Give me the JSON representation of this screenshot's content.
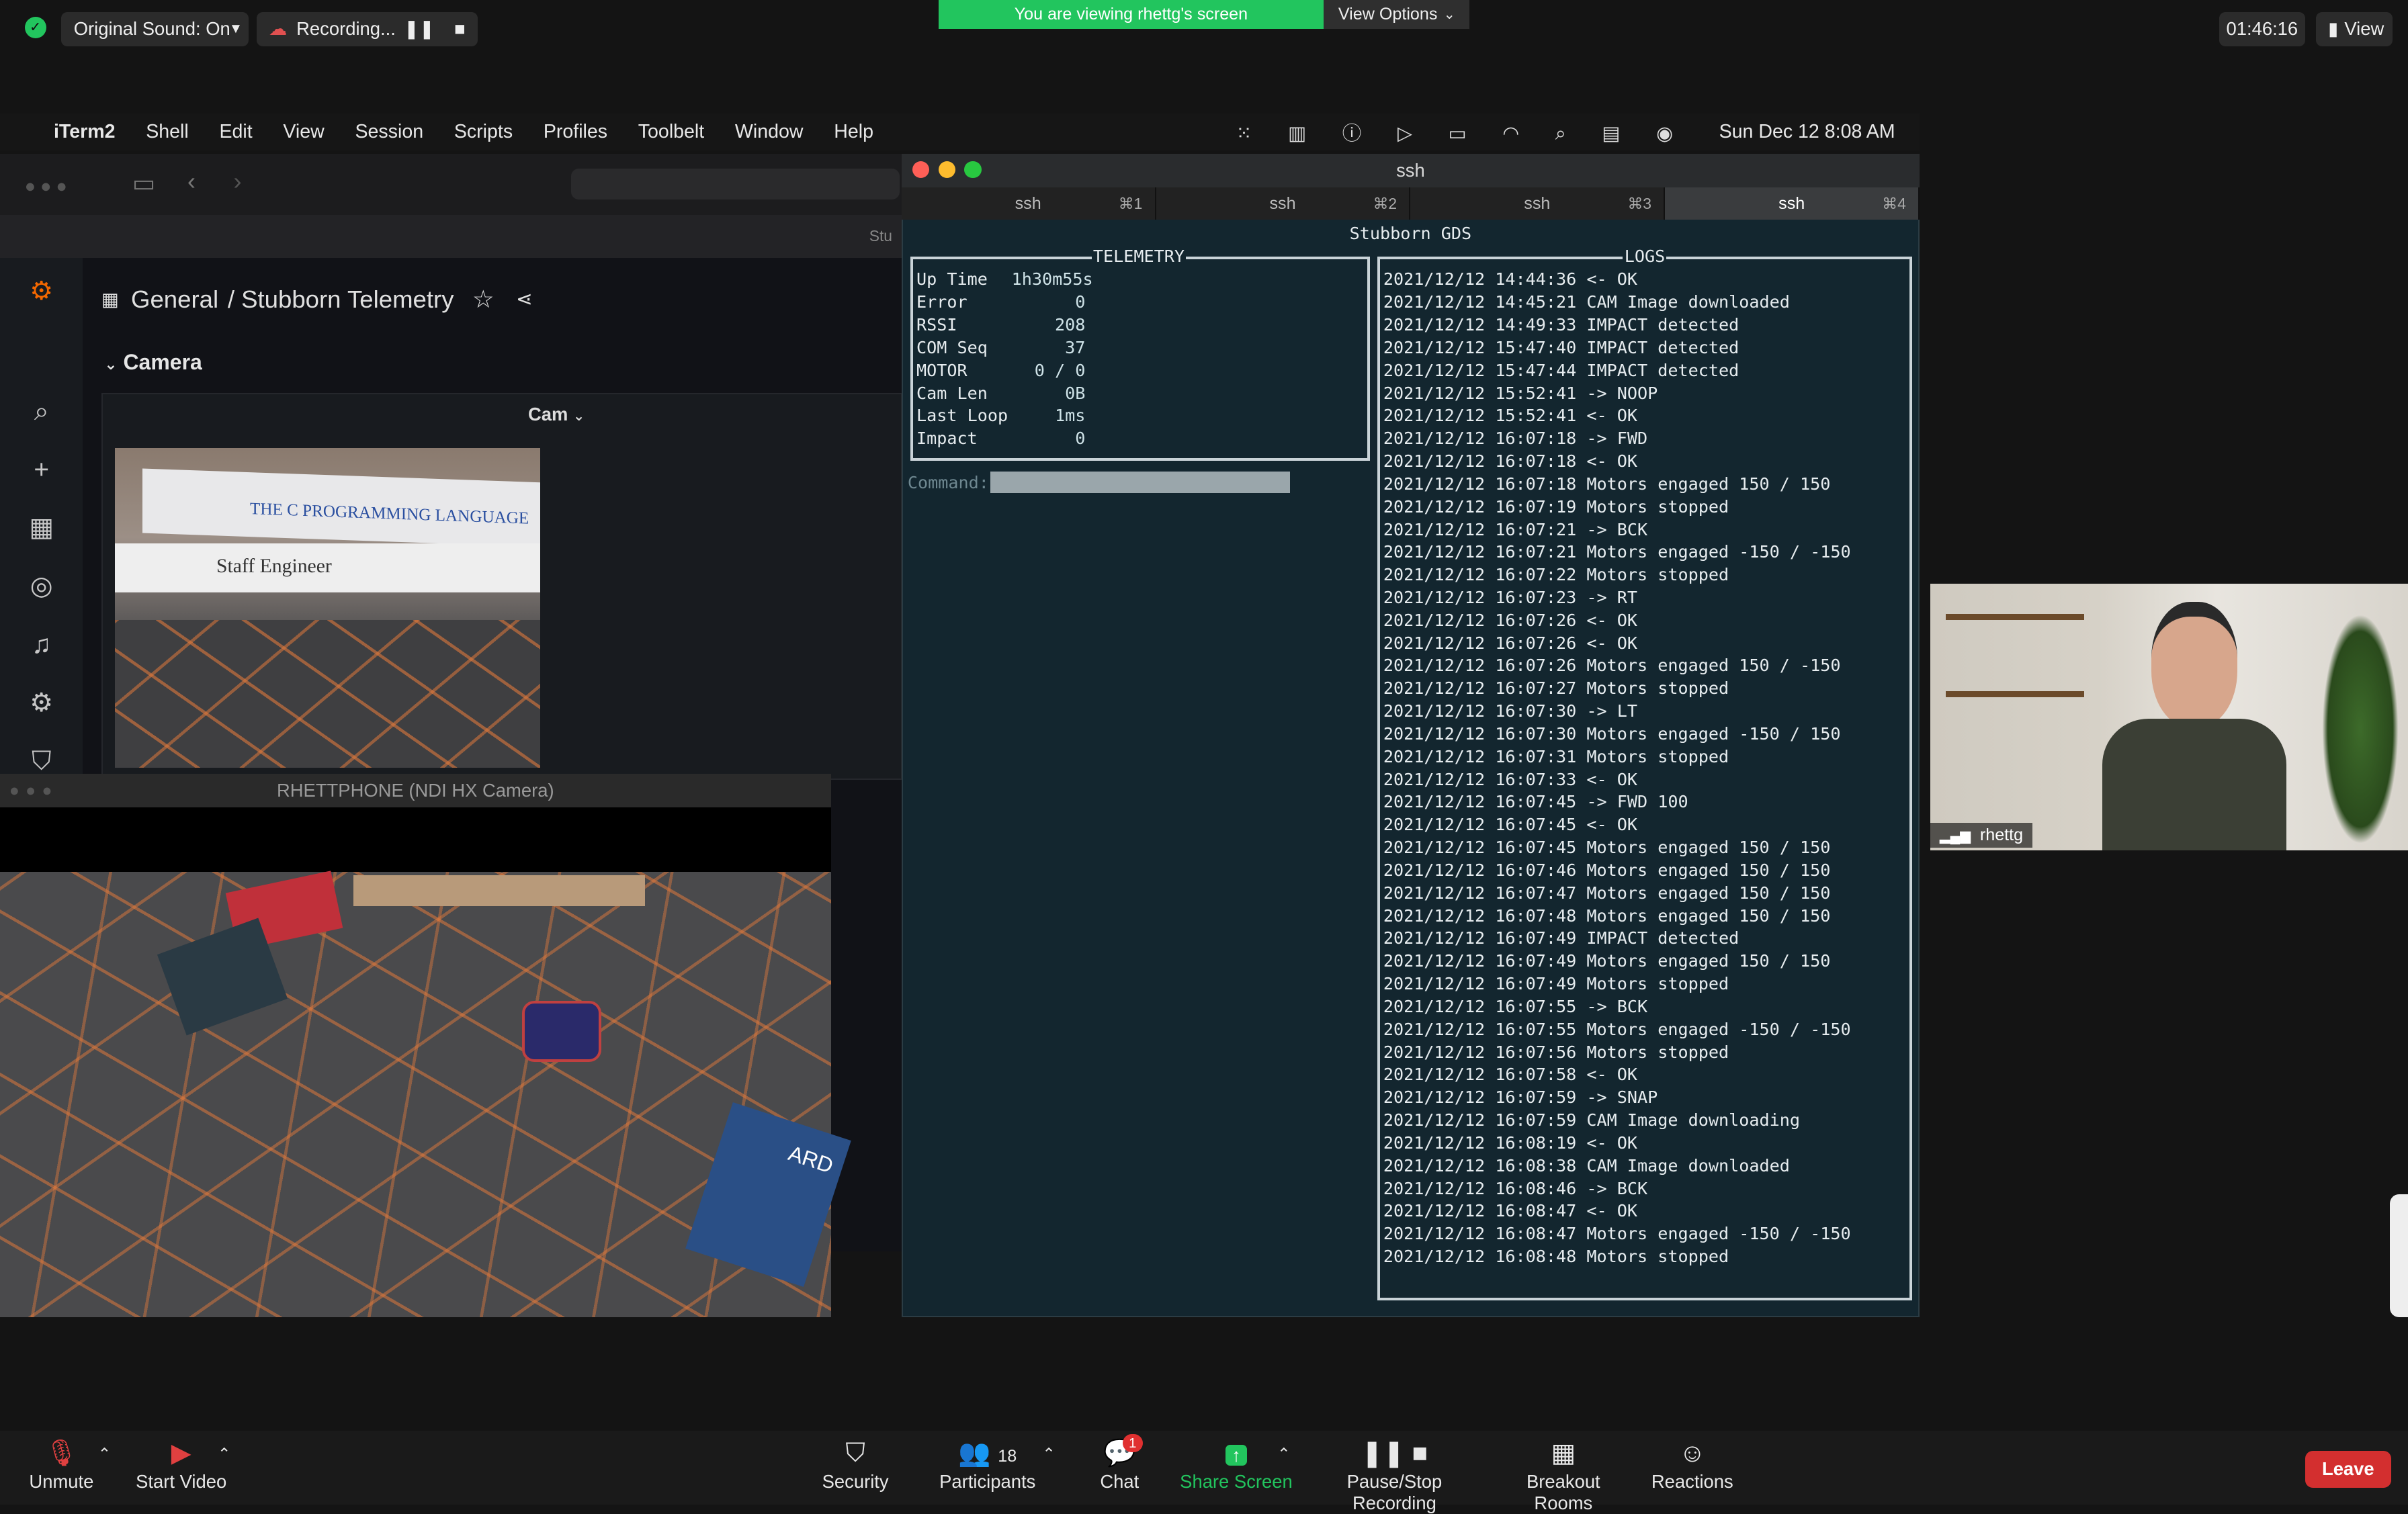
{
  "zoom": {
    "original_sound": "Original Sound: On",
    "recording": "Recording...",
    "viewing_banner": "You are viewing rhettg's screen",
    "view_options": "View Options",
    "clock": "01:46:16",
    "view_button": "View",
    "participant_name": "rhettg",
    "controls": {
      "unmute": "Unmute",
      "start_video": "Start Video",
      "security": "Security",
      "participants": "Participants",
      "participants_count": "18",
      "chat": "Chat",
      "chat_badge": "1",
      "share_screen": "Share Screen",
      "pause_stop": "Pause/Stop Recording",
      "breakout": "Breakout Rooms",
      "reactions": "Reactions",
      "leave": "Leave"
    },
    "colors": {
      "green": "#22c55e",
      "leave_red": "#d32f2f"
    }
  },
  "menubar": {
    "app": "iTerm2",
    "items": [
      "Shell",
      "Edit",
      "View",
      "Session",
      "Scripts",
      "Profiles",
      "Toolbelt",
      "Window",
      "Help"
    ],
    "datetime": "Sun Dec 12  8:08 AM"
  },
  "grafana": {
    "breadcrumb_general": "General",
    "breadcrumb_dash": "/ Stubborn Telemetry",
    "row_title": "Camera",
    "panel_title": "Cam",
    "book_title": "THE C PROGRAMMING LANGUAGE",
    "book2": "Staff Engineer",
    "tab_fragment": "Stu"
  },
  "phone_window": {
    "title": "RHETTPHONE (NDI HX Camera)",
    "book_text": "ARD"
  },
  "iterm": {
    "title": "ssh",
    "tabs": [
      {
        "label": "ssh",
        "key": "⌘1"
      },
      {
        "label": "ssh",
        "key": "⌘2"
      },
      {
        "label": "ssh",
        "key": "⌘3"
      },
      {
        "label": "ssh",
        "key": "⌘4"
      }
    ],
    "app_title": "Stubborn GDS",
    "telemetry_label": "TELEMETRY",
    "logs_label": "LOGS",
    "command_label": "Command:",
    "telemetry": [
      {
        "k": "Up Time",
        "v": "1h30m55s"
      },
      {
        "k": "Error",
        "v": "0"
      },
      {
        "k": "RSSI",
        "v": "208"
      },
      {
        "k": "COM Seq",
        "v": "37"
      },
      {
        "k": "MOTOR",
        "v": "0 / 0"
      },
      {
        "k": "Cam Len",
        "v": "0B"
      },
      {
        "k": "Last Loop",
        "v": "1ms"
      },
      {
        "k": "Impact",
        "v": "0"
      }
    ],
    "logs": [
      "2021/12/12 14:44:36 <- OK",
      "2021/12/12 14:45:21 CAM Image downloaded",
      "2021/12/12 14:49:33 IMPACT detected",
      "2021/12/12 15:47:40 IMPACT detected",
      "2021/12/12 15:47:44 IMPACT detected",
      "2021/12/12 15:52:41 -> NOOP",
      "2021/12/12 15:52:41 <- OK",
      "2021/12/12 16:07:18 -> FWD",
      "2021/12/12 16:07:18 <- OK",
      "2021/12/12 16:07:18 Motors engaged 150 / 150",
      "2021/12/12 16:07:19 Motors stopped",
      "2021/12/12 16:07:21 -> BCK",
      "2021/12/12 16:07:21 Motors engaged -150 / -150",
      "2021/12/12 16:07:22 Motors stopped",
      "2021/12/12 16:07:23 -> RT",
      "2021/12/12 16:07:26 <- OK",
      "2021/12/12 16:07:26 <- OK",
      "2021/12/12 16:07:26 Motors engaged 150 / -150",
      "2021/12/12 16:07:27 Motors stopped",
      "2021/12/12 16:07:30 -> LT",
      "2021/12/12 16:07:30 Motors engaged -150 / 150",
      "2021/12/12 16:07:31 Motors stopped",
      "2021/12/12 16:07:33 <- OK",
      "2021/12/12 16:07:45 -> FWD 100",
      "2021/12/12 16:07:45 <- OK",
      "2021/12/12 16:07:45 Motors engaged 150 / 150",
      "2021/12/12 16:07:46 Motors engaged 150 / 150",
      "2021/12/12 16:07:47 Motors engaged 150 / 150",
      "2021/12/12 16:07:48 Motors engaged 150 / 150",
      "2021/12/12 16:07:49 IMPACT detected",
      "2021/12/12 16:07:49 Motors engaged 150 / 150",
      "2021/12/12 16:07:49 Motors stopped",
      "2021/12/12 16:07:55 -> BCK",
      "2021/12/12 16:07:55 Motors engaged -150 / -150",
      "2021/12/12 16:07:56 Motors stopped",
      "2021/12/12 16:07:58 <- OK",
      "2021/12/12 16:07:59 -> SNAP",
      "2021/12/12 16:07:59 CAM Image downloading",
      "2021/12/12 16:08:19 <- OK",
      "2021/12/12 16:08:38 CAM Image downloaded",
      "2021/12/12 16:08:46 -> BCK",
      "2021/12/12 16:08:47 <- OK",
      "2021/12/12 16:08:47 Motors engaged -150 / -150",
      "2021/12/12 16:08:48 Motors stopped"
    ]
  }
}
